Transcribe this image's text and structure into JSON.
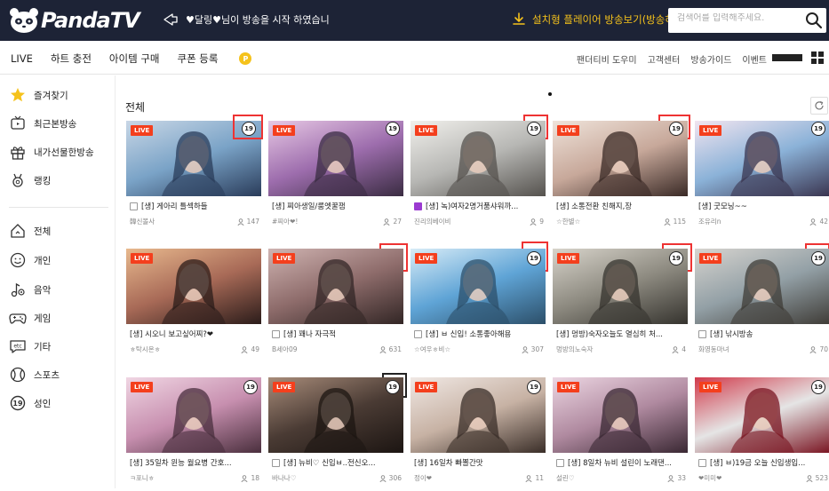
{
  "header": {
    "logo_text": "PandaTV",
    "notice": "♥달링♥님이 방송을 시작 하였습니",
    "install_label": "설치형 플레이어 방송보기(방송하기)",
    "search_placeholder": "검색어를 입력해주세요."
  },
  "subnav": {
    "left": [
      "LIVE",
      "하트 충전",
      "아이템 구매",
      "쿠폰 등록"
    ],
    "coupon_badge": "P",
    "right": [
      "팬더티비 도우미",
      "고객센터",
      "방송가이드",
      "이벤트"
    ]
  },
  "sidebar": {
    "top": [
      {
        "label": "즐겨찾기",
        "icon": "star-icon"
      },
      {
        "label": "최근본방송",
        "icon": "tv-icon"
      },
      {
        "label": "내가선물한방송",
        "icon": "gift-icon"
      },
      {
        "label": "랭킹",
        "icon": "medal-icon"
      }
    ],
    "categories": [
      {
        "label": "전체",
        "icon": "home-icon"
      },
      {
        "label": "개인",
        "icon": "smile-icon"
      },
      {
        "label": "음악",
        "icon": "music-icon"
      },
      {
        "label": "게임",
        "icon": "gamepad-icon"
      },
      {
        "label": "기타",
        "icon": "etc-icon"
      },
      {
        "label": "스포츠",
        "icon": "ball-icon"
      },
      {
        "label": "성인",
        "icon": "adult-icon"
      }
    ],
    "etc_icon_text": "etc",
    "adult_icon_text": "19"
  },
  "main": {
    "title": "전체",
    "cards": [
      {
        "title": "[생] 게아리 틀섹하들",
        "user": "韓신볼사",
        "viewers": "147",
        "icon": "tv",
        "colors": [
          "#7aa3c7",
          "#c9d7e6",
          "#2a3c5a"
        ]
      },
      {
        "title": "[생] 찌아생일/룸엣꿀잼",
        "user": "#찌아❤!",
        "viewers": "27",
        "icon": "none",
        "colors": [
          "#9d6dad",
          "#e7c8e4",
          "#3a2c42"
        ]
      },
      {
        "title": "[생] 녹)여자2명거품샤워까...",
        "user": "진리의베이비",
        "viewers": "9",
        "icon": "purple",
        "colors": [
          "#b7b7b4",
          "#f1f0ec",
          "#55524e"
        ]
      },
      {
        "title": "[생] 소통전환 친해지,장",
        "user": "☆한별☆",
        "viewers": "115",
        "icon": "none",
        "colors": [
          "#c7a89a",
          "#efe3da",
          "#3a2a26"
        ]
      },
      {
        "title": "[생] 굿모닝~~",
        "user": "조유리n",
        "viewers": "42",
        "icon": "none",
        "colors": [
          "#8bb2d8",
          "#f2e5f0",
          "#3a3550"
        ]
      },
      {
        "title": "[생] 시오니 보고싶어찌?❤",
        "user": "ㅎ탁시온ㅎ",
        "viewers": "49",
        "icon": "none",
        "colors": [
          "#a86a57",
          "#e8b98e",
          "#2b1c1a"
        ]
      },
      {
        "title": "[생] 꽤나 자극적",
        "user": "B세아09",
        "viewers": "631",
        "icon": "tv",
        "colors": [
          "#8e6c6b",
          "#cfb3b1",
          "#322625"
        ]
      },
      {
        "title": "[생] ㅂ 신입! 소통좋아해용",
        "user": "☆여우ㅎ비☆",
        "viewers": "307",
        "icon": "tv",
        "colors": [
          "#5fa4d6",
          "#d8ecf7",
          "#2c4f69"
        ]
      },
      {
        "title": "[생] 멍방)숙자오늘도 열심히 처...",
        "user": "멍방의노숙자",
        "viewers": "4",
        "icon": "none",
        "colors": [
          "#8d8a80",
          "#d8d4cb",
          "#35332e"
        ]
      },
      {
        "title": "[생] 낚시방송",
        "user": "화영동마녀",
        "viewers": "70",
        "icon": "tv",
        "colors": [
          "#93a0a6",
          "#d7d4cf",
          "#3f3c37"
        ]
      },
      {
        "title": "[생] 35일차 윈능 월요병 간호...",
        "user": "ㅋ포니ㅎ",
        "viewers": "18",
        "icon": "none",
        "colors": [
          "#c78faf",
          "#f0d6e3",
          "#4a2f3d"
        ]
      },
      {
        "title": "[생] 뉴비♡ 신입ㅂ..전신오...",
        "user": "바나나♡",
        "viewers": "306",
        "icon": "tv",
        "colors": [
          "#4a3b34",
          "#a88c7a",
          "#1c1512"
        ]
      },
      {
        "title": "[생] 16일차 빠뽈간맛",
        "user": "정이❤",
        "viewers": "11",
        "icon": "none",
        "colors": [
          "#c7b2a4",
          "#f0e8e4",
          "#3a2e28"
        ]
      },
      {
        "title": "[생] 8일차 뉴비 설린이 노래댄...",
        "user": "설린♡",
        "viewers": "33",
        "icon": "tv",
        "colors": [
          "#b08aa0",
          "#ecd6e2",
          "#3a2833"
        ]
      },
      {
        "title": "[생] ㅂ)19금 오늘 신입생입...",
        "user": "❤미미❤",
        "viewers": "523",
        "icon": "tv",
        "colors": [
          "#e5e5e5",
          "#d13a4b",
          "#7a1522"
        ]
      }
    ],
    "live_label": "LIVE",
    "age_label": "19"
  }
}
